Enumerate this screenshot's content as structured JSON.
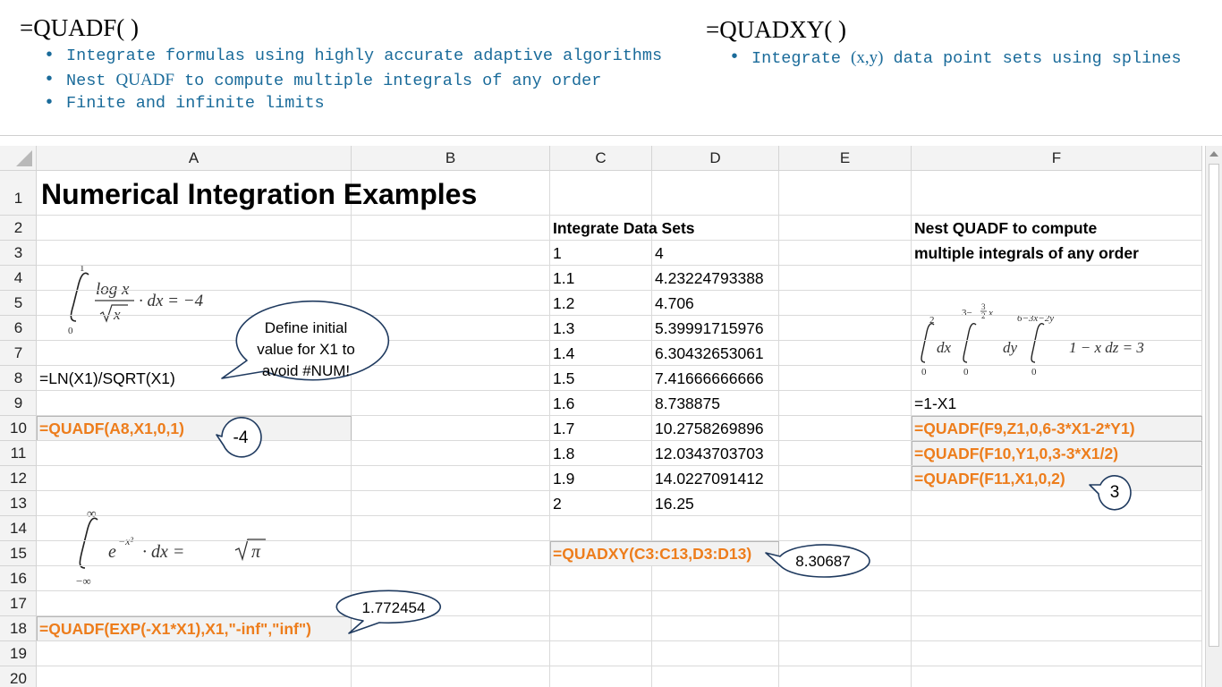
{
  "header": {
    "quadf": {
      "title": "=QUADF( )",
      "bullets": [
        {
          "text": "Integrate formulas using highly accurate adaptive algorithms"
        },
        {
          "pre": "Nest ",
          "mid": "QUADF",
          "post": " to compute multiple integrals of any order"
        },
        {
          "text": "Finite and infinite limits"
        }
      ]
    },
    "quadxy": {
      "title": "=QUADXY( )",
      "bullets": [
        {
          "pre": "Integrate ",
          "mid": "(x,y)",
          "post": " data point sets using splines"
        }
      ]
    }
  },
  "sheet": {
    "columns": [
      "A",
      "B",
      "C",
      "D",
      "E",
      "F"
    ],
    "rows": [
      "1",
      "2",
      "3",
      "4",
      "5",
      "6",
      "7",
      "8",
      "9",
      "10",
      "11",
      "12",
      "13",
      "14",
      "15",
      "16",
      "17",
      "18",
      "19",
      "20"
    ],
    "title": "Numerical Integration Examples",
    "a8": "=LN(X1)/SQRT(X1)",
    "a10": "=QUADF(A8,X1,0,1)",
    "a18": "=QUADF(EXP(-X1*X1),X1,\"-inf\",\"inf\")",
    "c2": "Integrate Data Sets",
    "data_sets": [
      {
        "x": "1",
        "y": "4"
      },
      {
        "x": "1.1",
        "y": "4.23224793388"
      },
      {
        "x": "1.2",
        "y": "4.706"
      },
      {
        "x": "1.3",
        "y": "5.39991715976"
      },
      {
        "x": "1.4",
        "y": "6.30432653061"
      },
      {
        "x": "1.5",
        "y": "7.41666666666"
      },
      {
        "x": "1.6",
        "y": "8.738875"
      },
      {
        "x": "1.7",
        "y": "10.2758269896"
      },
      {
        "x": "1.8",
        "y": "12.0343703703"
      },
      {
        "x": "1.9",
        "y": "14.0227091412"
      },
      {
        "x": "2",
        "y": "16.25"
      }
    ],
    "c15": "=QUADXY(C3:C13,D3:D13)",
    "f2": "Nest QUADF to compute",
    "f3": "multiple integrals of any order",
    "f9": "=1-X1",
    "f10": "=QUADF(F9,Z1,0,6-3*X1-2*Y1)",
    "f11": "=QUADF(F10,Y1,0,3-3*X1/2)",
    "f12": "=QUADF(F11,X1,0,2)"
  },
  "callouts": {
    "define_lines": [
      "Define initial",
      "value for X1 to",
      "avoid #NUM!"
    ],
    "result_a10": "-4",
    "result_a18": "1.772454",
    "result_c15": "8.30687",
    "result_f12": "3"
  },
  "math": {
    "eq1_upper": "1",
    "eq1_lower": "0",
    "eq1_log": "log x",
    "eq1_sqrt": "x",
    "eq1_rhs": "· dx = −4",
    "eq2_upper": "∞",
    "eq2_lower": "−∞",
    "eq2_base": "e",
    "eq2_exp": "−x²",
    "eq2_mid": "· dx =",
    "eq2_pi": "π",
    "eq3_u1": "2",
    "eq3_l1": "0",
    "eq3_dx": "dx",
    "eq3_u2a": "3−",
    "eq3_u2n": "3",
    "eq3_u2d": "2",
    "eq3_u2b": "x",
    "eq3_l2": "0",
    "eq3_dy": "dy",
    "eq3_u3": "6−3x−2y",
    "eq3_l3": "0",
    "eq3_rhs": "1 − x  dz = 3"
  },
  "colors": {
    "accent_orange": "#ed7d1c",
    "bullet_blue": "#1a6b9a"
  }
}
